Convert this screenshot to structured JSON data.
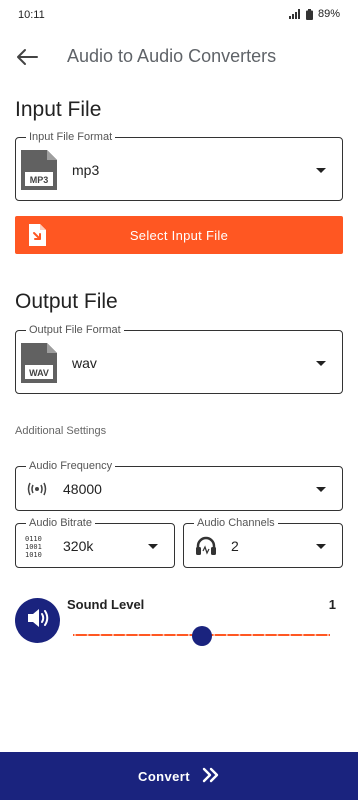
{
  "status": {
    "time": "10:11",
    "battery": "89%"
  },
  "app_bar": {
    "title": "Audio to Audio Converters",
    "back_icon": "arrow-left-icon"
  },
  "input": {
    "section_title": "Input File",
    "format_label": "Input File Format",
    "format_value": "mp3",
    "format_icon_text": "MP3",
    "select_button": "Select Input File"
  },
  "output": {
    "section_title": "Output File",
    "format_label": "Output File Format",
    "format_value": "wav",
    "format_icon_text": "WAV"
  },
  "additional": {
    "label": "Additional Settings",
    "frequency_label": "Audio Frequency",
    "frequency_value": "48000",
    "bitrate_label": "Audio Bitrate",
    "bitrate_value": "320k",
    "bitrate_icon_text": [
      "0110",
      "1001",
      "1010"
    ],
    "channels_label": "Audio Channels",
    "channels_value": "2"
  },
  "sound": {
    "label": "Sound Level",
    "value": "1",
    "slider_fraction": 0.5
  },
  "convert": {
    "label": "Convert"
  },
  "colors": {
    "accent": "#ff5722",
    "primary": "#1a237e"
  }
}
